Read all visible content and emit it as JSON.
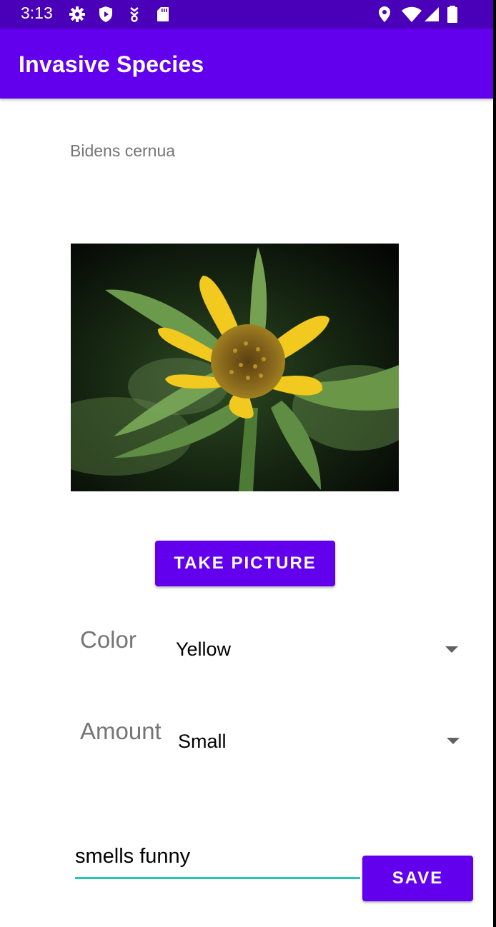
{
  "status_bar": {
    "time": "3:13",
    "left_icons": [
      "gear-icon",
      "shield-play-icon",
      "data-saver-icon",
      "sd-card-icon"
    ],
    "right_icons": [
      "location-icon",
      "wifi-icon",
      "signal-icon",
      "battery-icon"
    ]
  },
  "app_bar": {
    "title": "Invasive Species",
    "color": "#6200ee",
    "status_color": "#4a00b8"
  },
  "species": {
    "name": "Bidens cernua"
  },
  "buttons": {
    "take_picture": "TAKE PICTURE",
    "save": "SAVE"
  },
  "fields": {
    "color_label": "Color",
    "color_value": "Yellow",
    "amount_label": "Amount",
    "amount_value": "Small"
  },
  "notes": {
    "value": "smells funny",
    "underline_color": "#26c6b4"
  }
}
